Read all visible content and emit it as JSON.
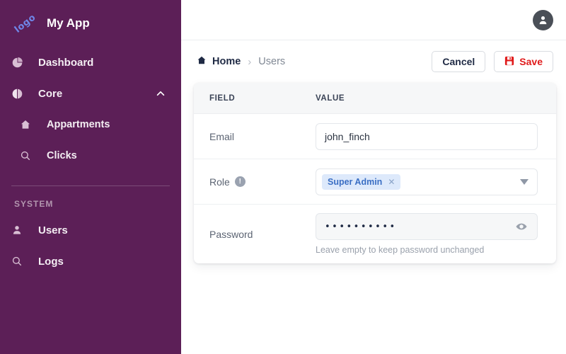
{
  "sidebar": {
    "logo_text": "logo",
    "app_title": "My App",
    "items": [
      {
        "label": "Dashboard",
        "icon": "pie-chart-icon",
        "level": "top"
      },
      {
        "label": "Core",
        "icon": "half-circle-icon",
        "level": "top",
        "expanded": true,
        "chevron": "chevron-up-icon"
      },
      {
        "label": "Appartments",
        "icon": "home-icon",
        "level": "sub"
      },
      {
        "label": "Clicks",
        "icon": "search-icon",
        "level": "sub"
      }
    ],
    "section_label": "SYSTEM",
    "system_items": [
      {
        "label": "Users",
        "icon": "user-icon"
      },
      {
        "label": "Logs",
        "icon": "search-icon"
      }
    ],
    "bg_color": "#5c1f57",
    "logo_color": "#6f86e8"
  },
  "topbar": {
    "avatar_icon": "user-avatar-icon"
  },
  "breadcrumb": {
    "home_label": "Home",
    "home_icon": "home-icon",
    "separator": "›",
    "current_label": "Users"
  },
  "actions": {
    "cancel_label": "Cancel",
    "save_label": "Save",
    "save_icon": "save-floppy-icon",
    "save_color": "#e01b1b"
  },
  "table": {
    "headers": {
      "field": "FIELD",
      "value": "VALUE"
    },
    "rows": [
      {
        "field": "Email",
        "has_info": false,
        "type": "text",
        "value": "john_finch",
        "placeholder": "",
        "hint": ""
      },
      {
        "field": "Role",
        "has_info": true,
        "info_icon": "info-icon",
        "type": "multiselect",
        "chips": [
          {
            "label": "Super Admin",
            "remove_icon": "close-icon"
          }
        ],
        "dropdown_icon": "caret-down-icon",
        "chip_bg": "#dde9fb",
        "chip_fg": "#3b6fc4",
        "hint": ""
      },
      {
        "field": "Password",
        "has_info": false,
        "type": "password",
        "value": "••••••••••",
        "toggle_icon": "eye-icon",
        "hint": "Leave empty to keep password unchanged"
      }
    ]
  }
}
